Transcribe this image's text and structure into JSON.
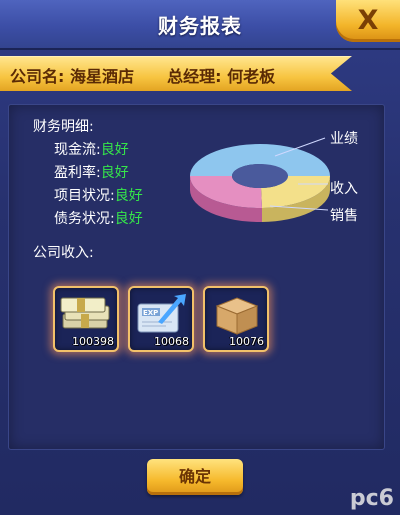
{
  "window": {
    "title": "财务报表",
    "close_label": "X"
  },
  "company": {
    "name_label": "公司名:",
    "name_value": "海星酒店",
    "manager_label": "总经理:",
    "manager_value": "何老板"
  },
  "details": {
    "title": "财务明细:",
    "rows": [
      {
        "label": "现金流:",
        "value": "良好"
      },
      {
        "label": "盈利率:",
        "value": "良好"
      },
      {
        "label": "项目状况:",
        "value": "良好"
      },
      {
        "label": "债务状况:",
        "value": "良好"
      }
    ]
  },
  "chart_data": {
    "type": "pie",
    "labels": [
      "业绩",
      "收入",
      "销售"
    ],
    "colors": [
      "#8ec6ee",
      "#f3e08a",
      "#e58fc1"
    ]
  },
  "income": {
    "title": "公司收入:",
    "items": [
      {
        "icon": "money-stack-icon",
        "count": "100398"
      },
      {
        "icon": "exp-card-icon",
        "count": "10068"
      },
      {
        "icon": "cardboard-box-icon",
        "count": "10076"
      }
    ]
  },
  "footer": {
    "confirm_label": "确定"
  },
  "watermark": "pc6"
}
